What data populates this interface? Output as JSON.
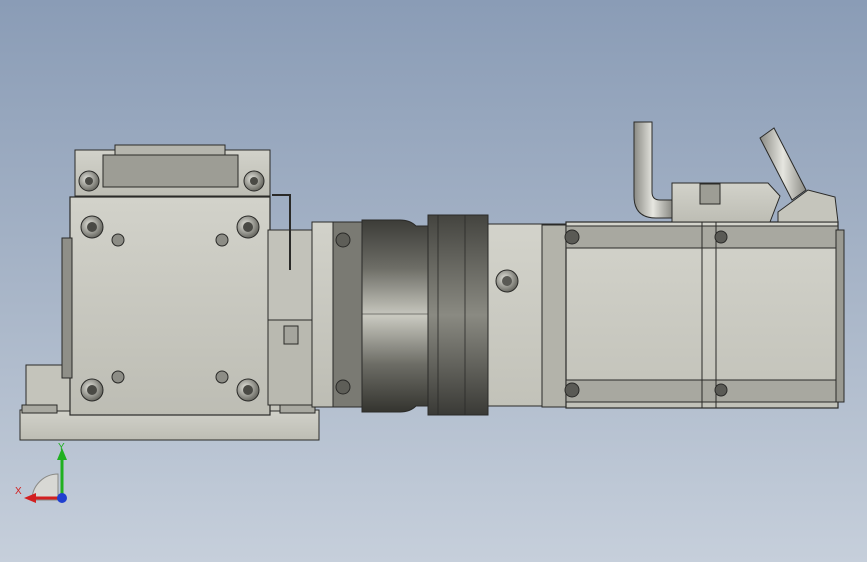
{
  "viewport": {
    "background_top": "#8a9cb6",
    "background_bottom": "#c6cfdb"
  },
  "model": {
    "parts": [
      "base-plate",
      "actuator-block",
      "coupling-housing",
      "gear-reducer",
      "servo-motor",
      "cable-gland-vertical",
      "cable-gland-angled",
      "connector-bracket"
    ],
    "body_color": "#c9c9c1",
    "dark_color": "#5a5a55",
    "edge_color": "#2a2a28"
  },
  "triad": {
    "x_label": "X",
    "y_label": "Y",
    "x_color": "#d22020",
    "y_color": "#20b020",
    "z_color": "#2040d0"
  }
}
